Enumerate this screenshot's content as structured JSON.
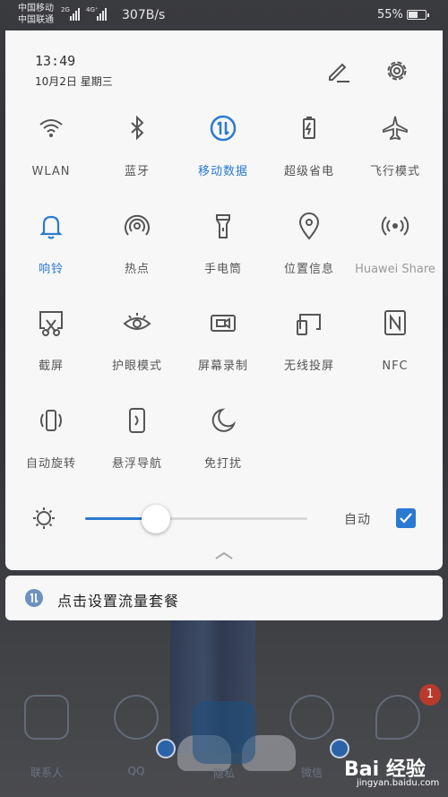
{
  "status_bar": {
    "carrier1": "中国移动",
    "carrier2": "中国联通",
    "net1": "2G",
    "net2": "4G⁺",
    "speed": "307B/s",
    "battery": "55%"
  },
  "panel": {
    "time": "13:49",
    "date": "10月2日 星期三",
    "tiles": [
      {
        "label": "WLAN",
        "icon": "wifi-icon",
        "active": false
      },
      {
        "label": "蓝牙",
        "icon": "bluetooth-icon",
        "active": false
      },
      {
        "label": "移动数据",
        "icon": "mobile-data-icon",
        "active": true
      },
      {
        "label": "超级省电",
        "icon": "battery-saver-icon",
        "active": false
      },
      {
        "label": "飞行模式",
        "icon": "airplane-icon",
        "active": false
      },
      {
        "label": "响铃",
        "icon": "bell-icon",
        "active": true
      },
      {
        "label": "热点",
        "icon": "hotspot-icon",
        "active": false
      },
      {
        "label": "手电筒",
        "icon": "flashlight-icon",
        "active": false
      },
      {
        "label": "位置信息",
        "icon": "location-icon",
        "active": false
      },
      {
        "label": "Huawei Share",
        "icon": "huawei-share-icon",
        "active": false
      },
      {
        "label": "截屏",
        "icon": "screenshot-icon",
        "active": false
      },
      {
        "label": "护眼模式",
        "icon": "eye-icon",
        "active": false
      },
      {
        "label": "屏幕录制",
        "icon": "screen-record-icon",
        "active": false
      },
      {
        "label": "无线投屏",
        "icon": "wireless-projection-icon",
        "active": false
      },
      {
        "label": "NFC",
        "icon": "nfc-icon",
        "active": false
      },
      {
        "label": "自动旋转",
        "icon": "auto-rotate-icon",
        "active": false
      },
      {
        "label": "悬浮导航",
        "icon": "floating-nav-icon",
        "active": false
      },
      {
        "label": "免打扰",
        "icon": "moon-icon",
        "active": false
      }
    ],
    "brightness": {
      "level": 0.32,
      "auto_label": "自动",
      "auto_checked": true
    },
    "accent_color": "#2b7ad1"
  },
  "notification": {
    "text": "点击设置流量套餐"
  },
  "dock": {
    "items": [
      {
        "label": "联系人"
      },
      {
        "label": "QQ"
      },
      {
        "label": "隐私"
      },
      {
        "label": "微信"
      }
    ],
    "badge": "1"
  },
  "watermark": {
    "brand": "Bai 经验",
    "url": "jingyan.baidu.com"
  }
}
